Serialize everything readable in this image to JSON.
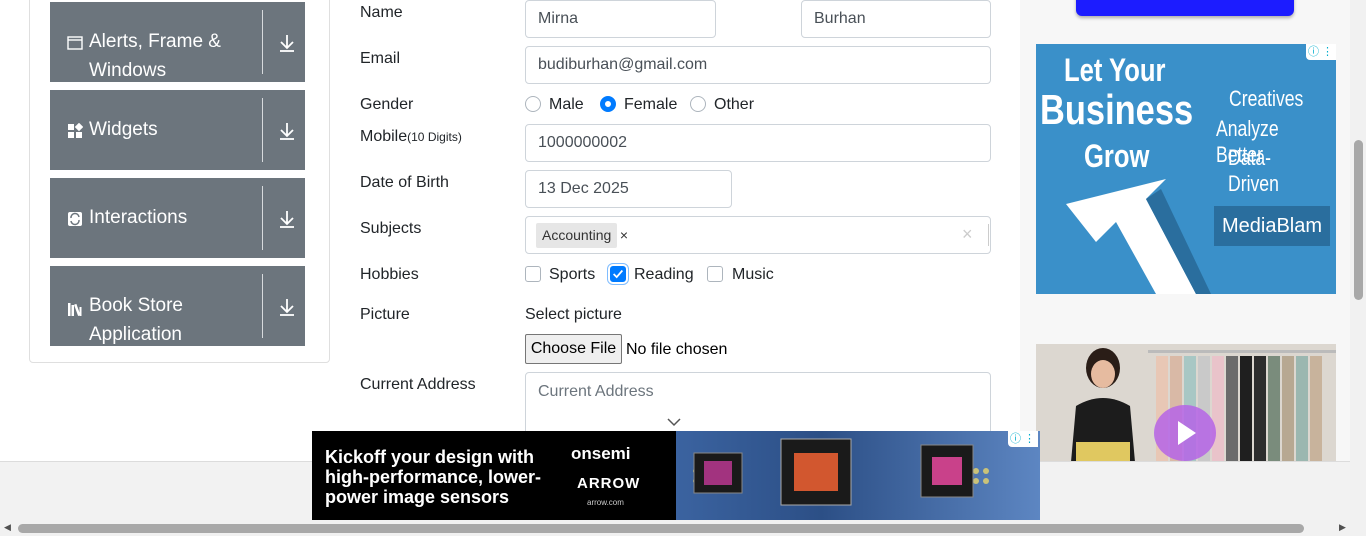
{
  "sidebar": {
    "groups": [
      {
        "label": "Alerts, Frame & Windows",
        "icon": "window-icon"
      },
      {
        "label": "Widgets",
        "icon": "widgets-icon"
      },
      {
        "label": "Interactions",
        "icon": "interactions-icon"
      },
      {
        "label": "Book Store Application",
        "icon": "books-icon"
      }
    ]
  },
  "form": {
    "name_label": "Name",
    "first_name": "Mirna",
    "last_name": "Burhan",
    "email_label": "Email",
    "email": "budiburhan@gmail.com",
    "gender_label": "Gender",
    "gender_options": [
      "Male",
      "Female",
      "Other"
    ],
    "gender_selected": "Female",
    "mobile_label": "Mobile",
    "mobile_hint": "(10 Digits)",
    "mobile": "1000000002",
    "dob_label": "Date of Birth",
    "dob": "13 Dec 2025",
    "subjects_label": "Subjects",
    "subject_chip": "Accounting",
    "chip_remove": "×",
    "clear_all": "×",
    "hobbies_label": "Hobbies",
    "hobbies": [
      "Sports",
      "Reading",
      "Music"
    ],
    "hobbies_checked": [
      "Reading"
    ],
    "picture_label": "Picture",
    "select_picture": "Select picture",
    "choose_file": "Choose File",
    "no_file": "No file chosen",
    "address_label": "Current Address",
    "address_placeholder": "Current Address"
  },
  "ads": {
    "right_top": {
      "line1": "Let Your",
      "line2": "Business",
      "line3": "Grow",
      "r1": "Creatives",
      "r2": "Analyze Better",
      "r3": "Data-Driven",
      "brand": "MediaBlam"
    },
    "bottom": {
      "headline": "Kickoff your design with high-performance, lower-power image sensors",
      "brand1": "onsemi",
      "brand2": "ARROW",
      "url": "arrow.com"
    }
  },
  "colors": {
    "sidebar_bg": "#6c757d",
    "accent": "#007bff",
    "ad_blue": "#3a90c9"
  }
}
